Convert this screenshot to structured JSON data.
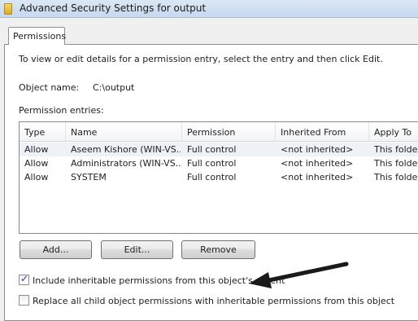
{
  "window": {
    "title": "Advanced Security Settings for output",
    "icon": "folder-icon"
  },
  "tabs": [
    {
      "label": "Permissions",
      "selected": true
    }
  ],
  "instructions": "To view or edit details for a permission entry, select the entry and then click Edit.",
  "object": {
    "label": "Object name:",
    "value": "C:\\output"
  },
  "permission_entries": {
    "label": "Permission entries:",
    "columns": [
      "Type",
      "Name",
      "Permission",
      "Inherited From",
      "Apply To"
    ],
    "rows": [
      {
        "type": "Allow",
        "name": "Aseem Kishore (WIN-VS...",
        "permission": "Full control",
        "inherited_from": "<not inherited>",
        "apply_to": "This folder,",
        "selected": true
      },
      {
        "type": "Allow",
        "name": "Administrators (WIN-VS...",
        "permission": "Full control",
        "inherited_from": "<not inherited>",
        "apply_to": "This folder,"
      },
      {
        "type": "Allow",
        "name": "SYSTEM",
        "permission": "Full control",
        "inherited_from": "<not inherited>",
        "apply_to": "This folder,"
      }
    ]
  },
  "buttons": {
    "add": "Add...",
    "edit": "Edit...",
    "remove": "Remove"
  },
  "checkboxes": {
    "include_inheritable": {
      "label": "Include inheritable permissions from this object's parent",
      "checked": true
    },
    "replace_child": {
      "label": "Replace all child object permissions with inheritable permissions from this object",
      "checked": false
    }
  },
  "annotation": {
    "icon": "arrow-icon",
    "color": "#1a1a1a"
  }
}
